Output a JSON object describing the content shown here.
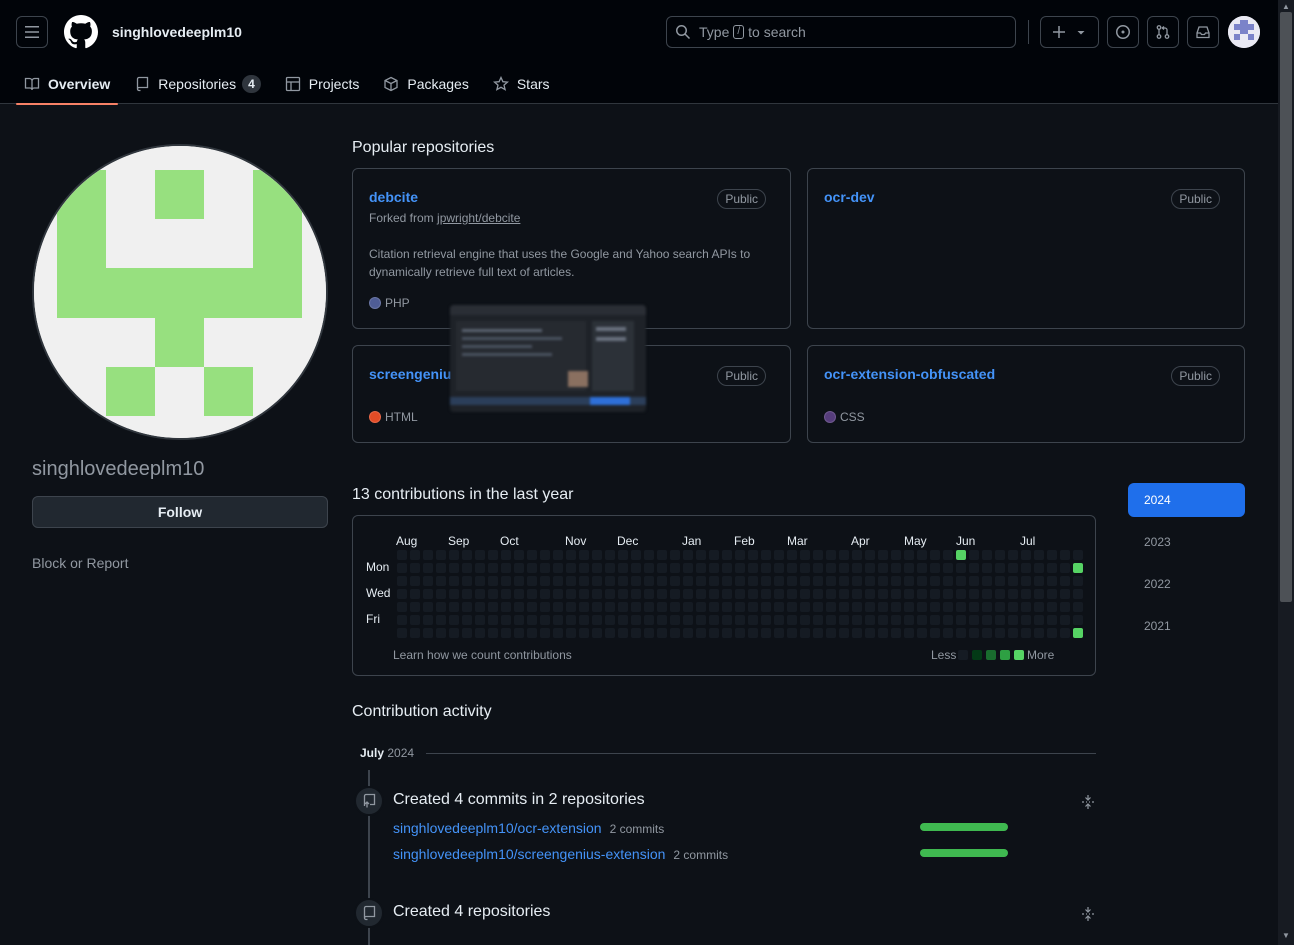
{
  "header": {
    "username": "singhlovedeeplm10",
    "search_prefix": "Type",
    "search_key": "/",
    "search_suffix": "to search"
  },
  "tabs": [
    {
      "label": "Overview",
      "icon": "book-icon"
    },
    {
      "label": "Repositories",
      "icon": "repo-icon",
      "count": "4"
    },
    {
      "label": "Projects",
      "icon": "table-icon"
    },
    {
      "label": "Packages",
      "icon": "package-icon"
    },
    {
      "label": "Stars",
      "icon": "star-icon"
    }
  ],
  "profile": {
    "name": "singhlovedeeplm10",
    "follow_label": "Follow",
    "block_label": "Block or Report"
  },
  "popular": {
    "title": "Popular repositories",
    "repos": [
      {
        "name": "debcite",
        "badge": "Public",
        "forked_prefix": "Forked from",
        "forked_from": "jpwright/debcite",
        "description": "Citation retrieval engine that uses the Google and Yahoo search APIs to dynamically retrieve full text of articles.",
        "language": "PHP",
        "lang_color": "#4F5D95"
      },
      {
        "name": "ocr-dev",
        "badge": "Public"
      },
      {
        "name": "screengeniu",
        "badge": "Public",
        "language": "HTML",
        "lang_color": "#e34c26"
      },
      {
        "name": "ocr-extension-obfuscated",
        "badge": "Public",
        "language": "CSS",
        "lang_color": "#563d7c"
      }
    ]
  },
  "contributions": {
    "title": "13 contributions in the last year",
    "months": [
      "Aug",
      "Sep",
      "Oct",
      "Nov",
      "Dec",
      "Jan",
      "Feb",
      "Mar",
      "Apr",
      "May",
      "Jun",
      "Jul"
    ],
    "days": [
      "Mon",
      "Wed",
      "Fri"
    ],
    "learn": "Learn how we count contributions",
    "less": "Less",
    "more": "More",
    "colors": [
      "#151b23",
      "#033a16",
      "#196c2e",
      "#2ea043",
      "#56d364"
    ]
  },
  "years": [
    "2024",
    "2023",
    "2022",
    "2021"
  ],
  "activity": {
    "title": "Contribution activity",
    "month": "July",
    "year": "2024",
    "commits_title": "Created 4 commits in 2 repositories",
    "commit_repos": [
      {
        "name": "singhlovedeeplm10/ocr-extension",
        "commits": "2 commits"
      },
      {
        "name": "singhlovedeeplm10/screengenius-extension",
        "commits": "2 commits"
      }
    ],
    "repos_title": "Created 4 repositories"
  }
}
